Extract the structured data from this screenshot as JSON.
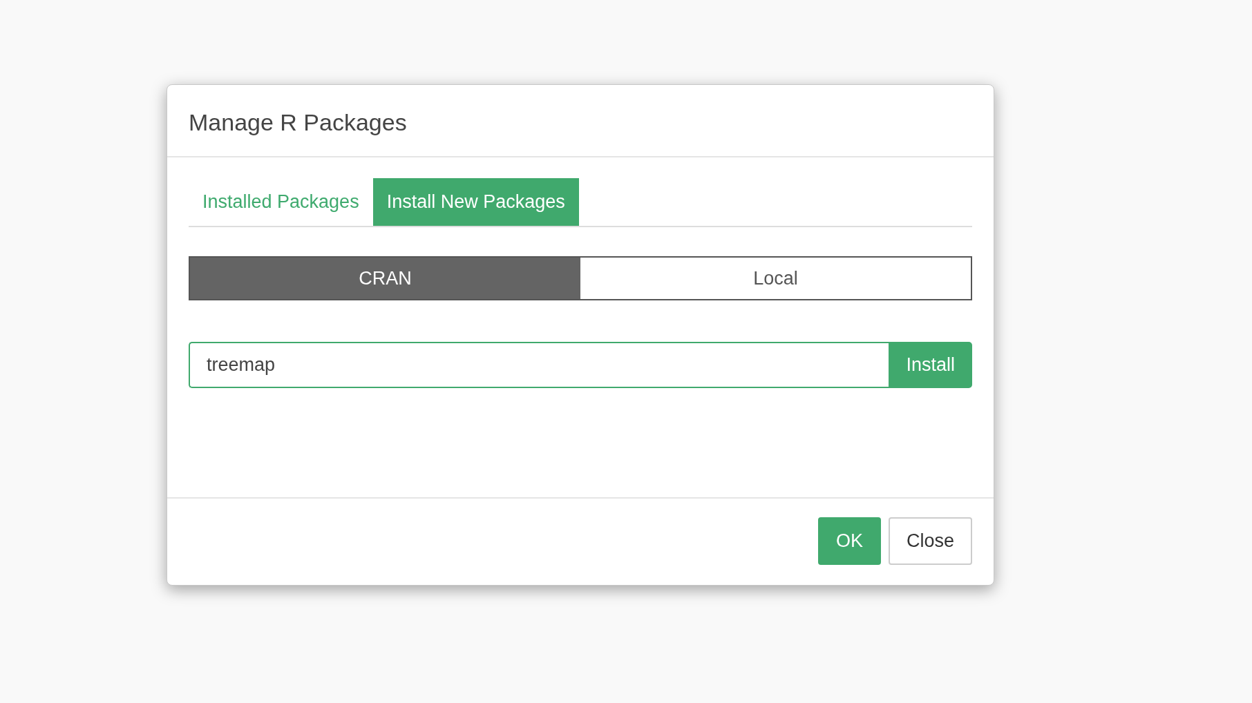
{
  "dialog": {
    "title": "Manage R Packages"
  },
  "tabs": [
    {
      "label": "Installed Packages",
      "selected": false
    },
    {
      "label": "Install New Packages",
      "selected": true
    }
  ],
  "source_toggle": [
    {
      "label": "CRAN",
      "selected": true
    },
    {
      "label": "Local",
      "selected": false
    }
  ],
  "package_field": {
    "value": "treemap"
  },
  "install_button": {
    "label": "Install"
  },
  "buttons": [
    {
      "label": "OK",
      "kind": "primary"
    },
    {
      "label": "Close",
      "kind": "default"
    }
  ]
}
